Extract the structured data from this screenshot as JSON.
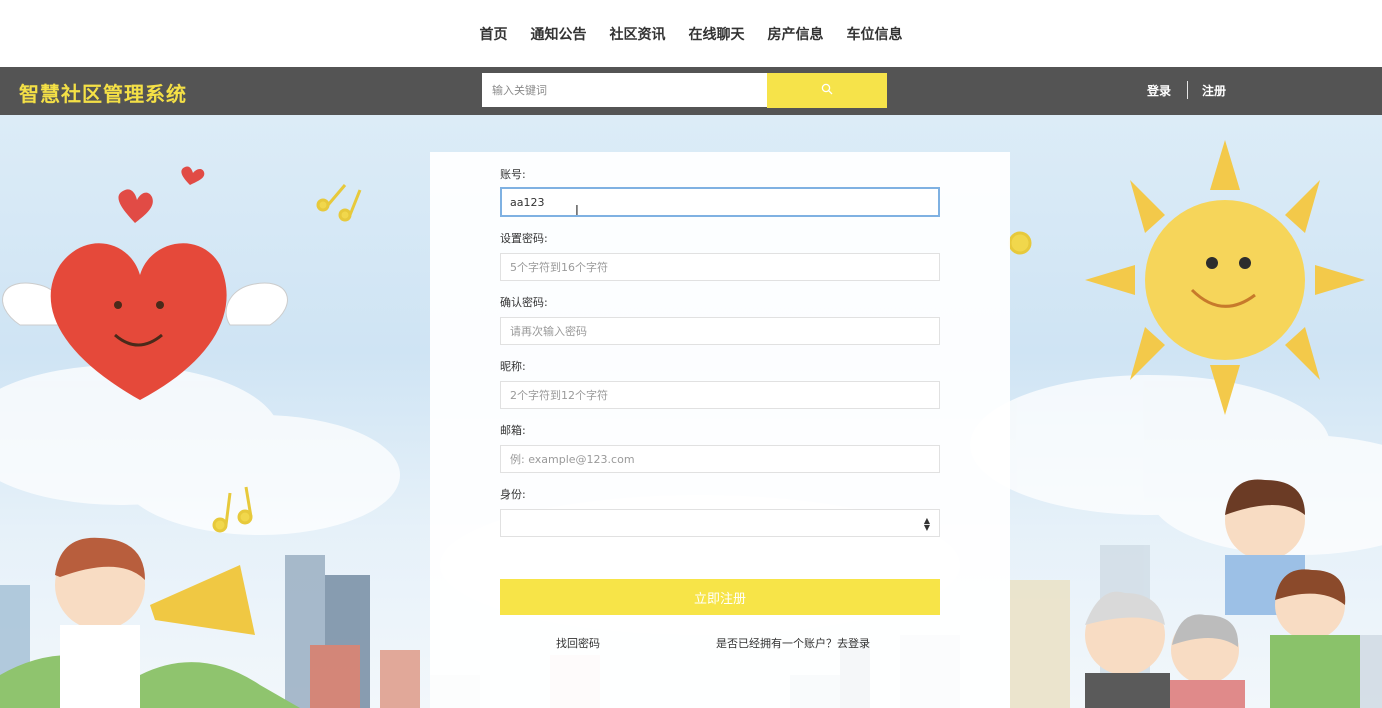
{
  "nav": {
    "items": [
      "首页",
      "通知公告",
      "社区资讯",
      "在线聊天",
      "房产信息",
      "车位信息"
    ]
  },
  "header": {
    "brand": "智慧社区管理系统",
    "search_placeholder": "输入关键词",
    "login": "登录",
    "register": "注册"
  },
  "form": {
    "account_label": "账号:",
    "account_value": "aa123",
    "password_label": "设置密码:",
    "password_placeholder": "5个字符到16个字符",
    "confirm_label": "确认密码:",
    "confirm_placeholder": "请再次输入密码",
    "nickname_label": "昵称:",
    "nickname_placeholder": "2个字符到12个字符",
    "email_label": "邮箱:",
    "email_placeholder": "例: example@123.com",
    "identity_label": "身份:",
    "identity_value": "",
    "submit_label": "立即注册",
    "forgot_password": "找回密码",
    "have_account": "是否已经拥有一个账户？去登录"
  },
  "colors": {
    "accent_yellow": "#f6e34a",
    "header_bg": "#545454",
    "brand_text": "#f4e046"
  }
}
